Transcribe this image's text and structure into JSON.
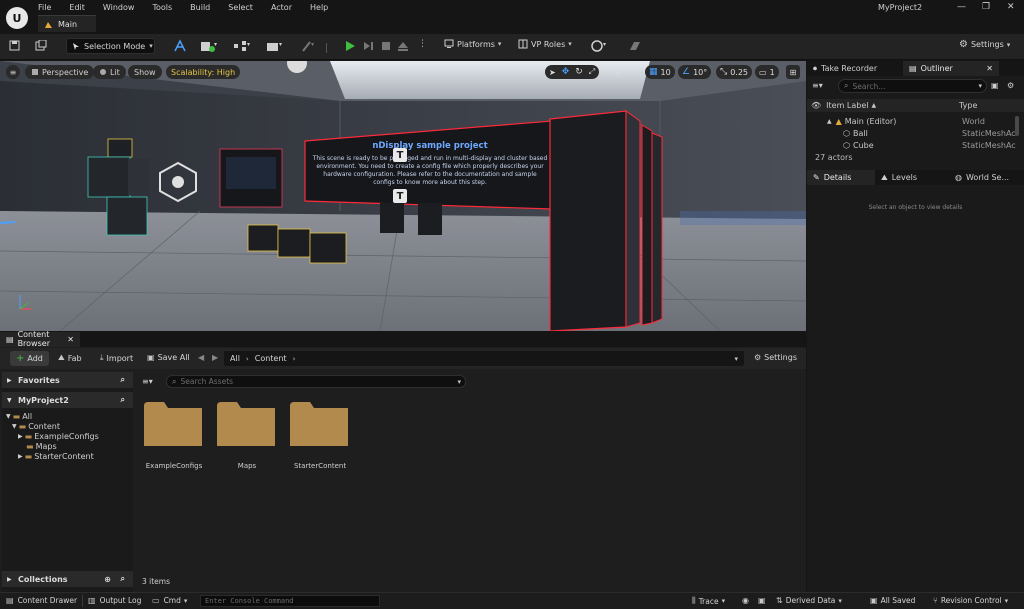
{
  "app": {
    "project_name": "MyProject2",
    "logo_text": "U"
  },
  "menu": [
    "File",
    "Edit",
    "Window",
    "Tools",
    "Build",
    "Select",
    "Actor",
    "Help"
  ],
  "level_tab": {
    "label": "Main"
  },
  "toolbar": {
    "selection_mode": "Selection Mode",
    "platforms": "Platforms",
    "vp_roles": "VP Roles",
    "settings": "Settings"
  },
  "viewport": {
    "perspective": "Perspective",
    "lit": "Lit",
    "show": "Show",
    "scalability": "Scalability: High",
    "grid_snap": "10",
    "rotation_snap": "10°",
    "scale_snap": "0.25",
    "camera_speed": "1",
    "banner_title": "nDisplay sample project",
    "banner_text": "This scene is ready to be packaged and run in multi-display and cluster based environment. You need to create a config file which properly describes your hardware configuration. Please refer to the documentation and sample configs to know more about this step."
  },
  "outliner": {
    "tabs": [
      "Take Recorder",
      "Outliner"
    ],
    "search_placeholder": "Search...",
    "col_label": "Item Label",
    "col_type": "Type",
    "rows": [
      {
        "label": "Main (Editor)",
        "type": "World"
      },
      {
        "label": "Ball",
        "type": "StaticMeshAc"
      },
      {
        "label": "Cube",
        "type": "StaticMeshAc"
      }
    ],
    "count": "27 actors"
  },
  "details": {
    "tabs": [
      "Details",
      "Levels",
      "World Se..."
    ],
    "empty_msg": "Select an object to view details"
  },
  "content_browser": {
    "tab": "Content Browser",
    "add": "Add",
    "fab": "Fab",
    "import": "Import",
    "save_all": "Save All",
    "path": [
      "All",
      "Content"
    ],
    "settings": "Settings",
    "favorites": "Favorites",
    "project": "MyProject2",
    "tree": [
      "All",
      "Content",
      "ExampleConfigs",
      "Maps",
      "StarterContent"
    ],
    "search_placeholder": "Search Assets",
    "assets": [
      "ExampleConfigs",
      "Maps",
      "StarterContent"
    ],
    "item_count": "3 items",
    "collections": "Collections",
    "folder_color": "#b38a4e"
  },
  "statusbar": {
    "content_drawer": "Content Drawer",
    "output_log": "Output Log",
    "cmd": "Cmd",
    "cmd_placeholder": "Enter Console Command",
    "trace": "Trace",
    "derived_data": "Derived Data",
    "all_saved": "All Saved",
    "revision_control": "Revision Control"
  }
}
